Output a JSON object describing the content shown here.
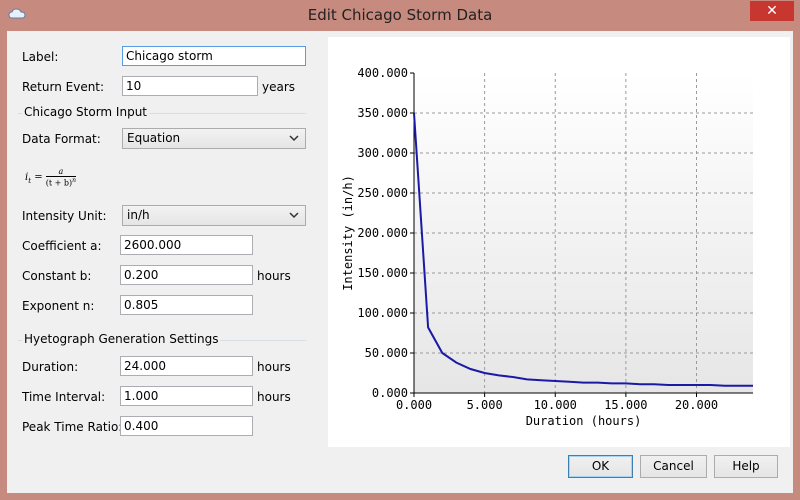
{
  "window": {
    "title": "Edit Chicago Storm Data",
    "close_label": "✕"
  },
  "form": {
    "label_caption": "Label:",
    "label_value": "Chicago storm",
    "return_event_caption": "Return Event:",
    "return_event_value": "10",
    "return_event_unit": "years",
    "chicago_group_title": "Chicago Storm Input",
    "data_format_caption": "Data Format:",
    "data_format_value": "Equation",
    "formula_lhs": "i",
    "formula_lhs_sub": "t",
    "formula_eq": "=",
    "formula_num": "a",
    "formula_den": "(t + b)",
    "formula_den_exp": "n",
    "intensity_unit_caption": "Intensity Unit:",
    "intensity_unit_value": "in/h",
    "coeff_a_caption": "Coefficient a:",
    "coeff_a_value": "2600.000",
    "const_b_caption": "Constant b:",
    "const_b_value": "0.200",
    "const_b_unit": "hours",
    "exponent_n_caption": "Exponent n:",
    "exponent_n_value": "0.805",
    "hyeto_group_title": "Hyetograph Generation Settings",
    "duration_caption": "Duration:",
    "duration_value": "24.000",
    "duration_unit": "hours",
    "time_interval_caption": "Time Interval:",
    "time_interval_value": "1.000",
    "time_interval_unit": "hours",
    "peak_ratio_caption": "Peak Time Ratio:",
    "peak_ratio_value": "0.400"
  },
  "buttons": {
    "ok": "OK",
    "cancel": "Cancel",
    "help": "Help"
  },
  "chart_data": {
    "type": "line",
    "xlabel": "Duration (hours)",
    "ylabel": "Intensity (in/h)",
    "xlim": [
      0,
      24
    ],
    "ylim": [
      0,
      400
    ],
    "x_ticks": [
      "0.000",
      "5.000",
      "10.000",
      "15.000",
      "20.000"
    ],
    "y_ticks": [
      "0.000",
      "50.000",
      "100.000",
      "150.000",
      "200.000",
      "250.000",
      "300.000",
      "350.000",
      "400.000"
    ],
    "grid": true,
    "line_color": "#1a1aa6",
    "series": [
      {
        "x": [
          0,
          1,
          2,
          3,
          4,
          5,
          6,
          7,
          8,
          9,
          10,
          11,
          12,
          13,
          14,
          15,
          16,
          17,
          18,
          19,
          20,
          21,
          22,
          23,
          24
        ],
        "values": [
          350,
          82,
          50,
          38,
          30,
          25,
          22,
          20,
          17,
          16,
          15,
          14,
          13,
          13,
          12,
          12,
          11,
          11,
          10,
          10,
          10,
          10,
          9,
          9,
          9
        ]
      }
    ]
  }
}
